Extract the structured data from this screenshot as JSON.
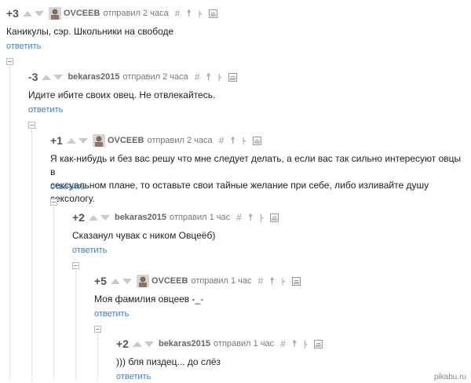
{
  "comments": [
    {
      "rating": "+3",
      "author": "OVCEEB",
      "time": "отправил 2 часа",
      "text": "Каникулы, сэр. Школьники на свободе",
      "reply": "ответить"
    },
    {
      "rating": "-3",
      "author": "bekaras2015",
      "time": "отправил 2 часа",
      "text": "Идите ибите своих овец. Не отвлекайтесь.",
      "reply": "ответить"
    },
    {
      "rating": "+1",
      "author": "OVCEEB",
      "time": "отправил 2 часа",
      "text_line1": "Я как-нибудь и без вас решу что мне следует делать, а если вас так сильно интересуют овцы в",
      "text_line2": "сексуальном плане, то оставьте свои тайные желание при себе, либо изливайте душу сексологу.",
      "reply": "ответить"
    },
    {
      "rating": "+2",
      "author": "bekaras2015",
      "time": "отправил 1 час",
      "text": "Сказанул чувак с ником Овцеёб)",
      "reply": "ответить"
    },
    {
      "rating": "+5",
      "author": "OVCEEB",
      "time": "отправил 1 час",
      "text": "Моя фамилия овцеев -_-",
      "reply": "ответить"
    },
    {
      "rating": "+2",
      "author": "bekaras2015",
      "time": "отправил 1 час",
      "text": "))) бля пиздец... до слёз",
      "reply": "ответить"
    }
  ],
  "tools": {
    "hash": "#",
    "pin": "☨",
    "link": "ﾄ"
  },
  "watermark": "pikabu.ru",
  "colors": {
    "link": "#3f7fb5",
    "arrow": "#c9c9c9"
  }
}
